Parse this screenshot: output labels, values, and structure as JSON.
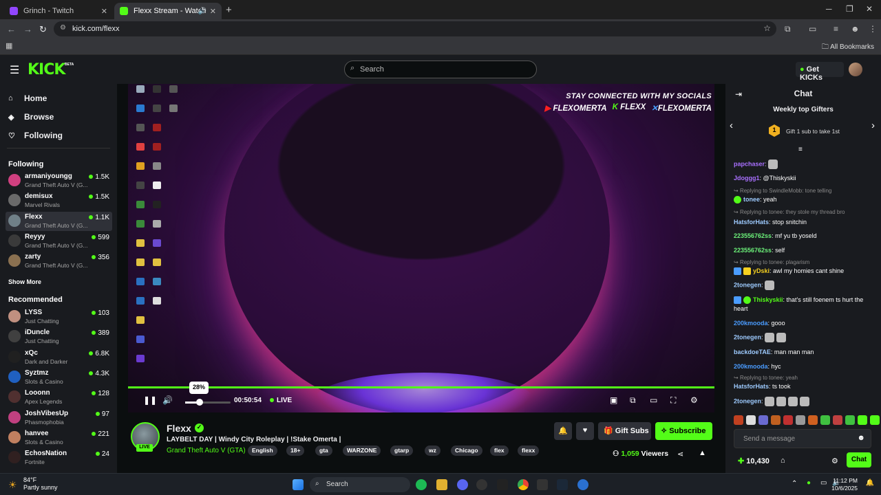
{
  "browser": {
    "tabs": [
      {
        "title": "Grinch - Twitch",
        "active": false,
        "icon_color": "#9146ff"
      },
      {
        "title": "Flexx Stream - Watch Live o",
        "active": true,
        "icon_color": "#53fc18"
      }
    ],
    "url": "kick.com/flexx",
    "bookmarks_label": "All Bookmarks"
  },
  "header": {
    "logo": "KICK",
    "beta": "BETA",
    "search_placeholder": "Search",
    "get_kicks": "Get KICKs"
  },
  "sidebar": {
    "nav": [
      {
        "label": "Home",
        "icon": "home-icon"
      },
      {
        "label": "Browse",
        "icon": "compass-icon"
      },
      {
        "label": "Following",
        "icon": "heart-icon"
      }
    ],
    "following_title": "Following",
    "following": [
      {
        "name": "armaniyoungg",
        "game": "Grand Theft Auto V (G...",
        "viewers": "1.5K",
        "color": "#d04080"
      },
      {
        "name": "demisux",
        "game": "Marvel Rivals",
        "viewers": "1.5K",
        "color": "#6a6a6a"
      },
      {
        "name": "Flexx",
        "game": "Grand Theft Auto V (G...",
        "viewers": "1.1K",
        "color": "#708088"
      },
      {
        "name": "Reyyy",
        "game": "Grand Theft Auto V (G...",
        "viewers": "599",
        "color": "#3a3a3a"
      },
      {
        "name": "zarty",
        "game": "Grand Theft Auto V (G...",
        "viewers": "356",
        "color": "#8a7050"
      }
    ],
    "show_more": "Show More",
    "recommended_title": "Recommended",
    "recommended": [
      {
        "name": "LYSS",
        "game": "Just Chatting",
        "viewers": "103",
        "color": "#c09080"
      },
      {
        "name": "iDuncle",
        "game": "Just Chatting",
        "viewers": "389",
        "color": "#404040"
      },
      {
        "name": "xQc",
        "game": "Dark and Darker",
        "viewers": "6.8K",
        "color": "#202020"
      },
      {
        "name": "Syztmz",
        "game": "Slots & Casino",
        "viewers": "4.3K",
        "color": "#2060c0"
      },
      {
        "name": "Looonn",
        "game": "Apex Legends",
        "viewers": "128",
        "color": "#503030"
      },
      {
        "name": "JoshVibesUp",
        "game": "Phasmophobia",
        "viewers": "97",
        "color": "#c04080"
      },
      {
        "name": "hanvee",
        "game": "Slots & Casino",
        "viewers": "221",
        "color": "#c08060"
      },
      {
        "name": "EchosNation",
        "game": "Fortnite",
        "viewers": "24",
        "color": "#302020"
      }
    ]
  },
  "video": {
    "socials_heading": "STAY CONNECTED WITH MY SOCIALS",
    "socials": [
      {
        "name": "FLEXOMERTA",
        "platform": "youtube"
      },
      {
        "name": "FLEXX",
        "platform": "kick"
      },
      {
        "name": "FLEXOMERTA",
        "platform": "x"
      }
    ],
    "volume_pct": "28%",
    "volume": 0.28,
    "time": "00:50:54",
    "live": "LIVE"
  },
  "stream": {
    "name": "Flexx",
    "live_badge": "LIVE",
    "title": "LAYBELT DAY | Windy City Roleplay | !Stake Omerta |",
    "category": "Grand Theft Auto V (GTA)",
    "tags": [
      "English",
      "18+",
      "gta",
      "WARZONE",
      "gtarp",
      "wz",
      "Chicago",
      "flex",
      "flexx"
    ],
    "gift_subs": "Gift Subs",
    "subscribe": "Subscribe",
    "viewers_count": "1,059",
    "viewers_label": "Viewers"
  },
  "chat": {
    "title": "Chat",
    "gifters_title": "Weekly top Gifters",
    "gift_rank": "1",
    "gift_prompt": "Gift 1 sub to take 1st",
    "messages": [
      {
        "user": "papchaser",
        "text": "",
        "color": "#a970ff"
      },
      {
        "user": "Jdoggg1",
        "text": "@Thiskyskii",
        "color": "#a970ff"
      },
      {
        "reply": "Replying to SwindleMobb: tone telling"
      },
      {
        "user": "tonee",
        "text": "yeah",
        "color": "#9ecbff"
      },
      {
        "reply": "Replying to tonee: they stole my thread bro"
      },
      {
        "user": "HatsforHats",
        "text": "stop snitchin",
        "color": "#9ecbff"
      },
      {
        "user": "223556762ss",
        "text": "mf yu tb yoseld",
        "color": "#6cf27a"
      },
      {
        "user": "223556762ss",
        "text": "self",
        "color": "#6cf27a"
      },
      {
        "reply": "Replying to tonee: plagarism"
      },
      {
        "user": "yDski",
        "text": "awl my homies cant shine",
        "color": "#f5d020"
      },
      {
        "user": "2tonegen",
        "text": "",
        "color": "#9ecbff"
      },
      {
        "user": "Thiskyskii",
        "text": "that's still foenem ts hurt the heart",
        "color": "#53fc18"
      },
      {
        "user": "200kmooda",
        "text": "gooo",
        "color": "#4a9cff"
      },
      {
        "user": "2tonegen",
        "text": "",
        "color": "#9ecbff"
      },
      {
        "user": "backdoeTAE",
        "text": "man man man",
        "color": "#9ecbff"
      },
      {
        "user": "200kmooda",
        "text": "hyc",
        "color": "#4a9cff"
      },
      {
        "reply": "Replying to tonee: yeah"
      },
      {
        "user": "HatsforHats",
        "text": "ts took",
        "color": "#9ecbff"
      },
      {
        "user": "2tonegen",
        "text": "",
        "color": "#9ecbff"
      }
    ],
    "send_placeholder": "Send a message",
    "kicks_balance": "10,430",
    "chat_button": "Chat"
  },
  "taskbar": {
    "temp": "84°F",
    "condition": "Partly sunny",
    "search": "Search",
    "time": "11:12 PM",
    "date": "10/6/2025"
  }
}
